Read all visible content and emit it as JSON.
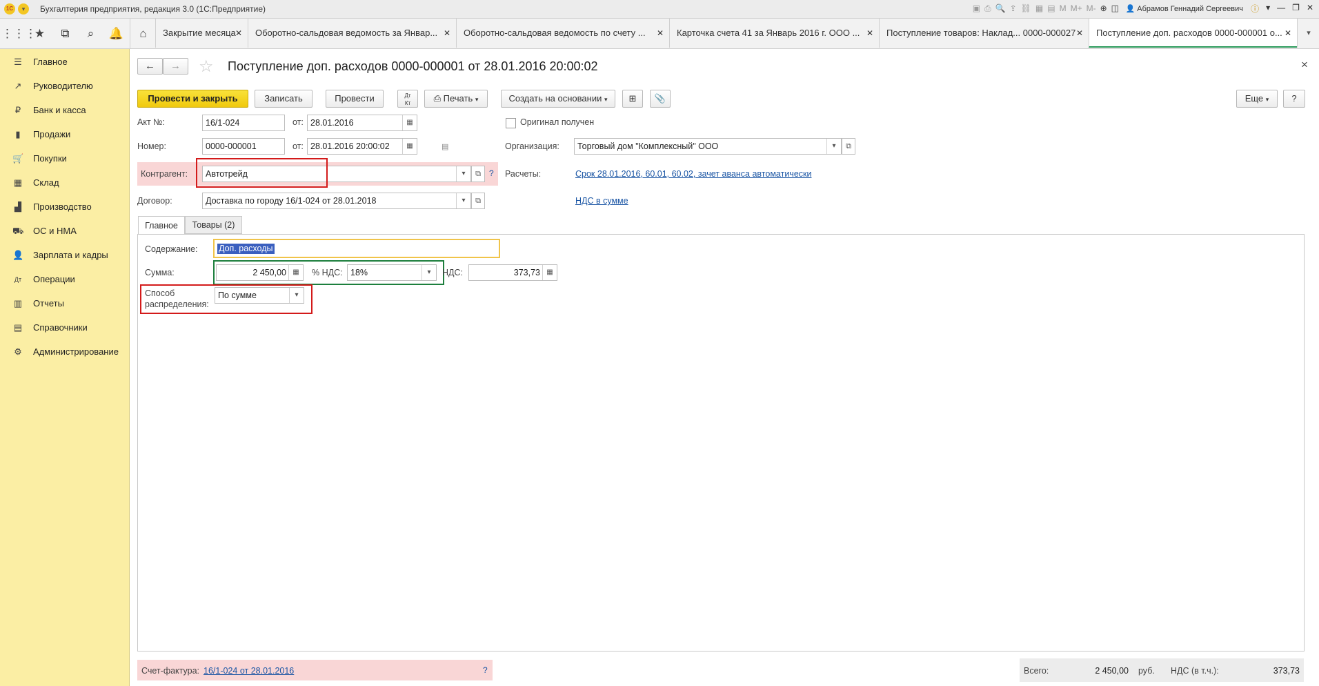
{
  "app": {
    "title": "Бухгалтерия предприятия, редакция 3.0  (1С:Предприятие)",
    "user": "Абрамов Геннадий Сергеевич",
    "toolbar_letters": [
      "M",
      "M+",
      "M-"
    ]
  },
  "tabs": [
    {
      "label": "Закрытие месяца"
    },
    {
      "label": "Оборотно-сальдовая ведомость за Январ..."
    },
    {
      "label": "Оборотно-сальдовая ведомость по счету ..."
    },
    {
      "label": "Карточка счета 41 за Январь 2016 г. ООО ..."
    },
    {
      "label": "Поступление товаров: Наклад... 0000-000027"
    },
    {
      "label": "Поступление доп. расходов 0000-000001 о..."
    }
  ],
  "sidebar": {
    "items": [
      {
        "label": "Главное",
        "icon": "menu-lines-icon"
      },
      {
        "label": "Руководителю",
        "icon": "trend-up-icon"
      },
      {
        "label": "Банк и касса",
        "icon": "ruble-coin-icon"
      },
      {
        "label": "Продажи",
        "icon": "shopping-bag-icon"
      },
      {
        "label": "Покупки",
        "icon": "cart-icon"
      },
      {
        "label": "Склад",
        "icon": "warehouse-grid-icon"
      },
      {
        "label": "Производство",
        "icon": "factory-icon"
      },
      {
        "label": "ОС и НМА",
        "icon": "truck-icon"
      },
      {
        "label": "Зарплата и кадры",
        "icon": "person-icon"
      },
      {
        "label": "Операции",
        "icon": "dt-kt-icon"
      },
      {
        "label": "Отчеты",
        "icon": "bar-chart-icon"
      },
      {
        "label": "Справочники",
        "icon": "books-icon"
      },
      {
        "label": "Администрирование",
        "icon": "gear-icon"
      }
    ]
  },
  "document": {
    "title": "Поступление доп. расходов 0000-000001 от 28.01.2016 20:00:02",
    "close_glyph": "×"
  },
  "toolbar": {
    "post_and_close": "Провести и закрыть",
    "save": "Записать",
    "post": "Провести",
    "print": "Печать",
    "create_based_on": "Создать на основании",
    "more": "Еще",
    "help": "?"
  },
  "header": {
    "act_label": "Акт №:",
    "act_value": "16/1-024",
    "act_from_label": "от:",
    "act_date": "28.01.2016",
    "number_label": "Номер:",
    "number_value": "0000-000001",
    "number_from_label": "от:",
    "number_date": "28.01.2016 20:00:02",
    "original_label": "Оригинал получен",
    "org_label": "Организация:",
    "org_value": "Торговый дом \"Комплексный\" ООО",
    "counterparty_label": "Контрагент:",
    "counterparty_value": "Автотрейд",
    "counterparty_help": "?",
    "payments_label": "Расчеты:",
    "payments_link": "Срок 28.01.2016, 60.01, 60.02, зачет аванса автоматически",
    "contract_label": "Договор:",
    "contract_value": "Доставка по городу 16/1-024 от 28.01.2018",
    "vat_link": "НДС в сумме"
  },
  "form_tabs": [
    {
      "label": "Главное"
    },
    {
      "label": "Товары (2)"
    }
  ],
  "main": {
    "content_label": "Содержание:",
    "content_value": "Доп. расходы",
    "sum_label": "Сумма:",
    "sum_value": "2 450,00",
    "vat_rate_label": "% НДС:",
    "vat_rate_value": "18%",
    "vat_label": "НДС:",
    "vat_value": "373,73",
    "distribution_label_1": "Способ",
    "distribution_label_2": "распределения:",
    "distribution_value": "По сумме"
  },
  "footer": {
    "invoice_label": "Счет-фактура:",
    "invoice_link": "16/1-024 от 28.01.2016",
    "invoice_help": "?",
    "total_label": "Всего:",
    "total_value": "2 450,00",
    "currency": "руб.",
    "vat_label": "НДС (в т.ч.):",
    "vat_value": "373,73"
  }
}
